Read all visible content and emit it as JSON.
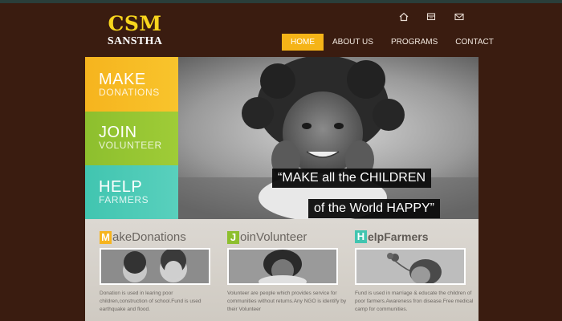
{
  "logo": {
    "line1": "CSM",
    "line2": "SANSTHA"
  },
  "utility_icons": [
    "home-icon",
    "sitemap-icon",
    "mail-icon"
  ],
  "nav": {
    "items": [
      {
        "label": "HOME",
        "active": true
      },
      {
        "label": "ABOUT US",
        "active": false
      },
      {
        "label": "PROGRAMS",
        "active": false
      },
      {
        "label": "CONTACT",
        "active": false
      }
    ]
  },
  "hero": {
    "ctas": [
      {
        "title": "MAKE",
        "subtitle": "DONATIONS",
        "color": "#f6b41e"
      },
      {
        "title": "JOIN",
        "subtitle": "VOLUNTEER",
        "color": "#8dbf2e"
      },
      {
        "title": "HELP",
        "subtitle": "FARMERS",
        "color": "#41c5b0"
      }
    ],
    "quote_line1": "“MAKE all the CHILDREN",
    "quote_line2": "of the World HAPPY”"
  },
  "columns": [
    {
      "initial": "M",
      "rest": "akeDonations",
      "color": "#f6b41e",
      "text": "Donation is used in learing poor children,construction of school.Fund is used earthquake and flood."
    },
    {
      "initial": "J",
      "rest": "oinVolunteer",
      "color": "#8dbf2e",
      "text": "Volunteer are people which provides service for communities without returns.Any NGO is identify by their Volunteer"
    },
    {
      "initial": "H",
      "rest": "elpFarmers",
      "color": "#41c5b0",
      "text": "Fund is used in marriage & educate the children of poor farmers.Awareness fron disease.Free medical camp for communities."
    }
  ],
  "colors": {
    "background": "#3a1c10",
    "logo": "#f7d51d",
    "nav_active": "#f5b418",
    "content_bg": "#d8d4ce"
  }
}
